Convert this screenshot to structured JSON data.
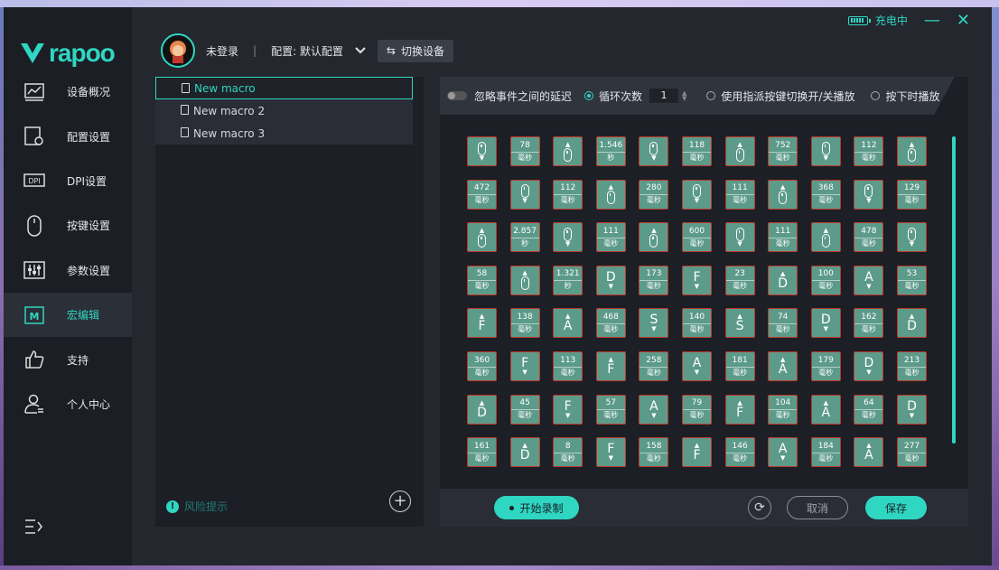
{
  "brand": {
    "logo_text": "rapoo",
    "accent": "#2fd6c2"
  },
  "titlebar": {
    "battery_status": "充电中",
    "minimize": "—",
    "close": "✕"
  },
  "header": {
    "login": "未登录",
    "separator": "|",
    "config": "配置: 默认配置",
    "switch_device": "切换设备"
  },
  "sidebar": {
    "items": [
      {
        "label": "设备概况",
        "icon": "chart-icon"
      },
      {
        "label": "配置设置",
        "icon": "config-icon"
      },
      {
        "label": "DPI设置",
        "icon": "dpi-icon"
      },
      {
        "label": "按键设置",
        "icon": "mouse-icon"
      },
      {
        "label": "参数设置",
        "icon": "sliders-icon"
      },
      {
        "label": "宏编辑",
        "icon": "macro-icon",
        "active": true
      },
      {
        "label": "支持",
        "icon": "thumbs-up-icon"
      },
      {
        "label": "个人中心",
        "icon": "user-icon"
      }
    ]
  },
  "macros": {
    "items": [
      {
        "label": "New macro",
        "active": true
      },
      {
        "label": "New macro 2"
      },
      {
        "label": "New macro 3"
      }
    ],
    "risk_hint": "风险提示"
  },
  "options": {
    "ignore_delay": "忽略事件之间的延迟",
    "loop_count_label": "循环次数",
    "loop_count": "1",
    "toggle_play": "使用指派按键切换开/关播放",
    "press_play": "按下时播放"
  },
  "unit_ms": "毫秒",
  "unit_s": "秒",
  "grid_rows": [
    [
      {
        "t": "m",
        "d": "dn"
      },
      {
        "t": "d",
        "v": "78",
        "u": "ms"
      },
      {
        "t": "m",
        "d": "up"
      },
      {
        "t": "d",
        "v": "1.546",
        "u": "s"
      },
      {
        "t": "m",
        "d": "dn"
      },
      {
        "t": "d",
        "v": "118",
        "u": "ms"
      },
      {
        "t": "m",
        "d": "up"
      },
      {
        "t": "d",
        "v": "752",
        "u": "ms"
      },
      {
        "t": "m",
        "d": "dn"
      },
      {
        "t": "d",
        "v": "112",
        "u": "ms"
      },
      {
        "t": "m",
        "d": "up"
      }
    ],
    [
      {
        "t": "d",
        "v": "472",
        "u": "ms"
      },
      {
        "t": "m",
        "d": "dn"
      },
      {
        "t": "d",
        "v": "112",
        "u": "ms"
      },
      {
        "t": "m",
        "d": "up"
      },
      {
        "t": "d",
        "v": "280",
        "u": "ms"
      },
      {
        "t": "m",
        "d": "dn"
      },
      {
        "t": "d",
        "v": "111",
        "u": "ms"
      },
      {
        "t": "m",
        "d": "up"
      },
      {
        "t": "d",
        "v": "368",
        "u": "ms"
      },
      {
        "t": "m",
        "d": "dn"
      },
      {
        "t": "d",
        "v": "129",
        "u": "ms"
      }
    ],
    [
      {
        "t": "m",
        "d": "up"
      },
      {
        "t": "d",
        "v": "2.857",
        "u": "s"
      },
      {
        "t": "m",
        "d": "dn"
      },
      {
        "t": "d",
        "v": "111",
        "u": "ms"
      },
      {
        "t": "m",
        "d": "up"
      },
      {
        "t": "d",
        "v": "600",
        "u": "ms"
      },
      {
        "t": "m",
        "d": "dn"
      },
      {
        "t": "d",
        "v": "111",
        "u": "ms"
      },
      {
        "t": "m",
        "d": "up"
      },
      {
        "t": "d",
        "v": "478",
        "u": "ms"
      },
      {
        "t": "m",
        "d": "dn"
      }
    ],
    [
      {
        "t": "d",
        "v": "58",
        "u": "ms"
      },
      {
        "t": "m",
        "d": "up"
      },
      {
        "t": "d",
        "v": "1.321",
        "u": "s"
      },
      {
        "t": "k",
        "k": "D",
        "d": "dn"
      },
      {
        "t": "d",
        "v": "173",
        "u": "ms"
      },
      {
        "t": "k",
        "k": "F",
        "d": "dn"
      },
      {
        "t": "d",
        "v": "23",
        "u": "ms"
      },
      {
        "t": "k",
        "k": "D",
        "d": "up"
      },
      {
        "t": "d",
        "v": "100",
        "u": "ms"
      },
      {
        "t": "k",
        "k": "A",
        "d": "dn"
      },
      {
        "t": "d",
        "v": "53",
        "u": "ms"
      }
    ],
    [
      {
        "t": "k",
        "k": "F",
        "d": "up"
      },
      {
        "t": "d",
        "v": "138",
        "u": "ms"
      },
      {
        "t": "k",
        "k": "A",
        "d": "up"
      },
      {
        "t": "d",
        "v": "468",
        "u": "ms"
      },
      {
        "t": "k",
        "k": "S",
        "d": "dn"
      },
      {
        "t": "d",
        "v": "140",
        "u": "ms"
      },
      {
        "t": "k",
        "k": "S",
        "d": "up"
      },
      {
        "t": "d",
        "v": "74",
        "u": "ms"
      },
      {
        "t": "k",
        "k": "D",
        "d": "dn"
      },
      {
        "t": "d",
        "v": "162",
        "u": "ms"
      },
      {
        "t": "k",
        "k": "D",
        "d": "up"
      }
    ],
    [
      {
        "t": "d",
        "v": "360",
        "u": "ms"
      },
      {
        "t": "k",
        "k": "F",
        "d": "dn"
      },
      {
        "t": "d",
        "v": "113",
        "u": "ms"
      },
      {
        "t": "k",
        "k": "F",
        "d": "up"
      },
      {
        "t": "d",
        "v": "258",
        "u": "ms"
      },
      {
        "t": "k",
        "k": "A",
        "d": "dn"
      },
      {
        "t": "d",
        "v": "181",
        "u": "ms"
      },
      {
        "t": "k",
        "k": "A",
        "d": "up"
      },
      {
        "t": "d",
        "v": "179",
        "u": "ms"
      },
      {
        "t": "k",
        "k": "D",
        "d": "dn"
      },
      {
        "t": "d",
        "v": "213",
        "u": "ms"
      }
    ],
    [
      {
        "t": "k",
        "k": "D",
        "d": "up"
      },
      {
        "t": "d",
        "v": "45",
        "u": "ms"
      },
      {
        "t": "k",
        "k": "F",
        "d": "dn"
      },
      {
        "t": "d",
        "v": "57",
        "u": "ms"
      },
      {
        "t": "k",
        "k": "A",
        "d": "dn"
      },
      {
        "t": "d",
        "v": "79",
        "u": "ms"
      },
      {
        "t": "k",
        "k": "F",
        "d": "up"
      },
      {
        "t": "d",
        "v": "104",
        "u": "ms"
      },
      {
        "t": "k",
        "k": "A",
        "d": "up"
      },
      {
        "t": "d",
        "v": "64",
        "u": "ms"
      },
      {
        "t": "k",
        "k": "D",
        "d": "dn"
      }
    ],
    [
      {
        "t": "d",
        "v": "161",
        "u": "ms"
      },
      {
        "t": "k",
        "k": "D",
        "d": "up"
      },
      {
        "t": "d",
        "v": "8",
        "u": "ms"
      },
      {
        "t": "k",
        "k": "F",
        "d": "dn"
      },
      {
        "t": "d",
        "v": "158",
        "u": "ms"
      },
      {
        "t": "k",
        "k": "F",
        "d": "up"
      },
      {
        "t": "d",
        "v": "146",
        "u": "ms"
      },
      {
        "t": "k",
        "k": "A",
        "d": "dn"
      },
      {
        "t": "d",
        "v": "184",
        "u": "ms"
      },
      {
        "t": "k",
        "k": "A",
        "d": "up"
      },
      {
        "t": "d",
        "v": "277",
        "u": "ms"
      }
    ]
  ],
  "buttons": {
    "record": "开始录制",
    "cancel": "取消",
    "save": "保存",
    "refresh": "⟳",
    "add": "+"
  }
}
